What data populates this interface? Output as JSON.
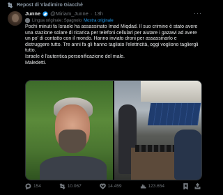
{
  "repost": {
    "label": "Repost di Vladimiro Giacchè"
  },
  "author": {
    "name": "Junne",
    "handle": "@Miriam_Junne",
    "separator": "·",
    "time": "13h"
  },
  "translation": {
    "label": "Lingua originale: Spagnolo",
    "link": "Mostra originale"
  },
  "tweet": {
    "p1": "Pochi minuti fa Israele ha assassinato Imad Miqdad. Il suo crimine è stato avere una stazione solare di ricarica per telefoni cellulari per aiutare i gazawi ad avere un po' di contatto con il mondo. Hanno inviato droni per assassinarlo e distruggere tutto. Tre anni fa gli hanno tagliato l'elettricità, oggi vogliono tagliergli tutto.",
    "p2": "Israele è l'autentica personificazione del male.",
    "p3": "Maledetti."
  },
  "metrics": {
    "replies": "154",
    "reposts": "10.067",
    "likes": "14.459",
    "views": "123.654"
  },
  "colors": {
    "accent": "#1d9bf0",
    "muted": "#71767b",
    "text": "#e7e9ea",
    "background": "#000000"
  },
  "icons": [
    "repost-icon",
    "verified-badge-icon",
    "more-icon",
    "globe-icon",
    "reply-icon",
    "like-icon",
    "views-icon",
    "bookmark-icon",
    "share-icon"
  ]
}
